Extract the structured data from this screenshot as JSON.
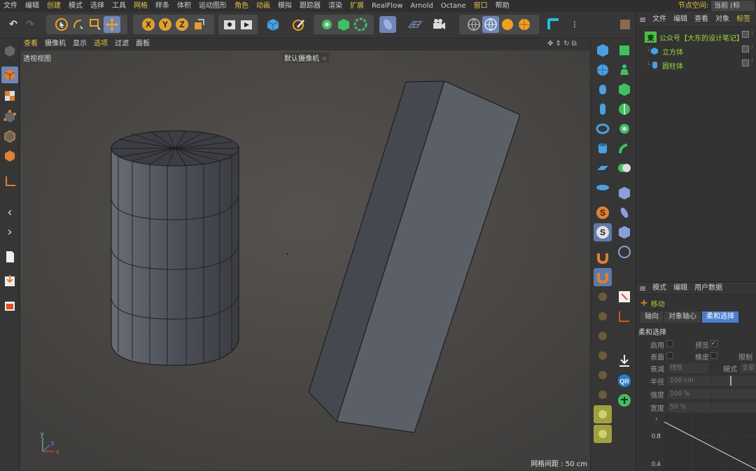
{
  "menubar": {
    "items": [
      {
        "label": "文件",
        "hl": false
      },
      {
        "label": "编辑",
        "hl": false
      },
      {
        "label": "创建",
        "hl": true
      },
      {
        "label": "模式",
        "hl": false
      },
      {
        "label": "选择",
        "hl": false
      },
      {
        "label": "工具",
        "hl": false
      },
      {
        "label": "网格",
        "hl": true
      },
      {
        "label": "样条",
        "hl": false
      },
      {
        "label": "体积",
        "hl": false
      },
      {
        "label": "运动图形",
        "hl": false
      },
      {
        "label": "角色",
        "hl": true
      },
      {
        "label": "动画",
        "hl": true
      },
      {
        "label": "模拟",
        "hl": false
      },
      {
        "label": "跟踪器",
        "hl": false
      },
      {
        "label": "渲染",
        "hl": false
      },
      {
        "label": "扩展",
        "hl": true
      },
      {
        "label": "RealFlow",
        "hl": false
      },
      {
        "label": "Arnold",
        "hl": false
      },
      {
        "label": "Octane",
        "hl": false
      },
      {
        "label": "窗口",
        "hl": true
      },
      {
        "label": "帮助",
        "hl": false
      }
    ],
    "node_space_label": "节点空间:",
    "current_label": "当前 (标"
  },
  "toolbar": {
    "axis_x": "X",
    "axis_y": "Y",
    "axis_z": "Z"
  },
  "viewport": {
    "menu": [
      {
        "label": "查看",
        "hl": true
      },
      {
        "label": "摄像机",
        "hl": false
      },
      {
        "label": "显示",
        "hl": false
      },
      {
        "label": "选项",
        "hl": true
      },
      {
        "label": "过滤",
        "hl": false
      },
      {
        "label": "面板",
        "hl": false
      }
    ],
    "view_name": "透视视图",
    "camera_name": "默认摄像机 ⁘",
    "grid_spacing": "网格间距 : 50 cm",
    "nav_icons": "✥ ⇕ ↻ ⧉",
    "axis_labels": {
      "x": "x",
      "y": "y",
      "z": "z"
    }
  },
  "object_manager": {
    "menu": [
      {
        "label": "文件",
        "hl": false
      },
      {
        "label": "编辑",
        "hl": false
      },
      {
        "label": "查看",
        "hl": false
      },
      {
        "label": "对象",
        "hl": false
      },
      {
        "label": "标签",
        "hl": true
      }
    ],
    "objects": [
      {
        "name": "公众号【大东的设计笔记】",
        "icon": "東",
        "type": "null-icon"
      },
      {
        "name": "立方体",
        "icon": "cube-icon",
        "type": "cube"
      },
      {
        "name": "圆柱体",
        "icon": "cylinder-icon",
        "type": "cylinder"
      }
    ]
  },
  "attribute_manager": {
    "menu": [
      {
        "label": "模式",
        "hl": false
      },
      {
        "label": "编辑",
        "hl": false
      },
      {
        "label": "用户数据",
        "hl": false
      }
    ],
    "tool_name": "移动",
    "tabs": [
      {
        "label": "轴向",
        "active": false
      },
      {
        "label": "对象轴心",
        "active": false
      },
      {
        "label": "柔和选择",
        "active": true
      }
    ],
    "section_title": "柔和选择",
    "fields": {
      "enable": "启用",
      "preview": "预览",
      "surface": "表面",
      "rubber": "橡皮",
      "restrict": "限制",
      "falloff": "衰减",
      "falloff_value": "线性",
      "mode": "模式",
      "mode_value": "全部",
      "radius": "半径",
      "radius_value": "100 cm",
      "strength": "强度",
      "strength_value": "100 %",
      "width": "宽度",
      "width_value": "50 %"
    },
    "graph_ticks": [
      "0.8",
      "0.4"
    ]
  },
  "colors": {
    "accent_yellow": "#e0c040",
    "object_green": "#9bd43b",
    "axis_red": "#d04020",
    "tab_active": "#4a7fd0"
  }
}
